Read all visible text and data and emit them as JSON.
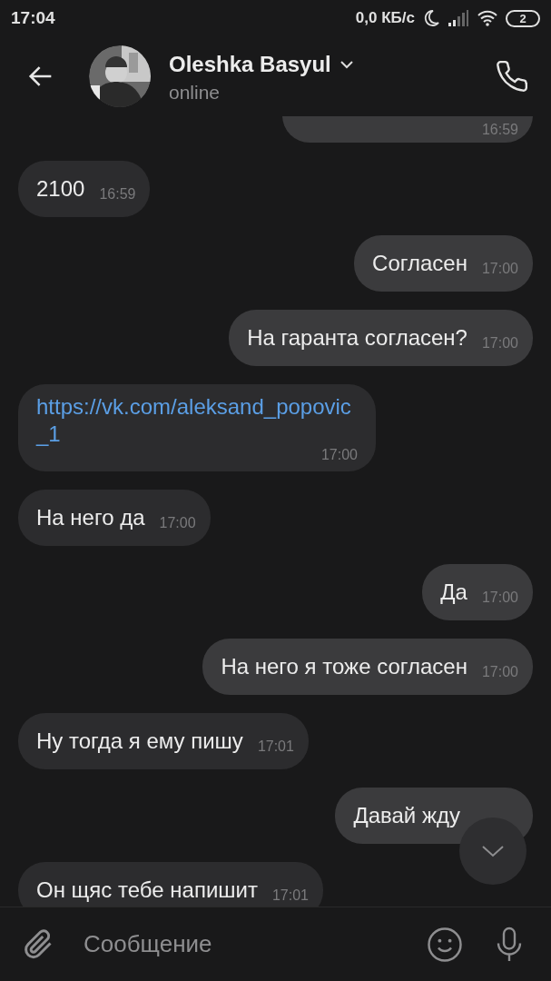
{
  "status_bar": {
    "time": "17:04",
    "speed": "0,0 КБ/с",
    "battery": "2"
  },
  "header": {
    "name": "Oleshka Basyul",
    "status": "online"
  },
  "messages": [
    {
      "kind": "text",
      "outgoing": true,
      "time": "16:59"
    },
    {
      "kind": "text",
      "outgoing": false,
      "text": "2100",
      "time": "16:59"
    },
    {
      "kind": "text",
      "outgoing": true,
      "text": "Согласен",
      "time": "17:00"
    },
    {
      "kind": "text",
      "outgoing": true,
      "text": "На гаранта согласен?",
      "time": "17:00"
    },
    {
      "kind": "link",
      "outgoing": false,
      "text": "https://vk.com/aleksand_popovic_1",
      "time": "17:00"
    },
    {
      "kind": "text",
      "outgoing": false,
      "text": "На него да",
      "time": "17:00"
    },
    {
      "kind": "text",
      "outgoing": true,
      "text": "Да",
      "time": "17:00"
    },
    {
      "kind": "text",
      "outgoing": true,
      "text": "На него я тоже согласен",
      "time": "17:00"
    },
    {
      "kind": "text",
      "outgoing": false,
      "text": "Ну тогда я ему пишу",
      "time": "17:01"
    },
    {
      "kind": "text",
      "outgoing": true,
      "text": "Давай жду"
    },
    {
      "kind": "text",
      "outgoing": false,
      "text": "Он щяс тебе напишит",
      "time": "17:01"
    }
  ],
  "composer": {
    "placeholder": "Сообщение"
  }
}
